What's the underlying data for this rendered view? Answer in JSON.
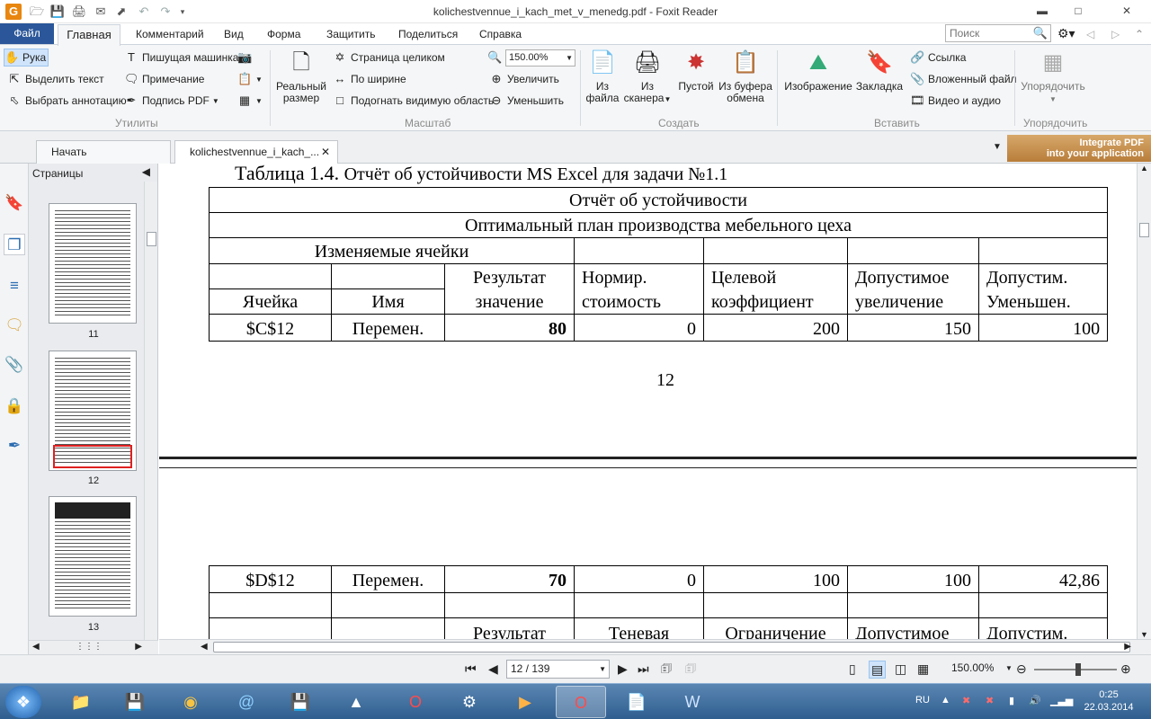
{
  "window": {
    "title": "kolichestvennue_i_kach_met_v_menedg.pdf - Foxit Reader"
  },
  "menubar": {
    "file": "Файл",
    "tabs": [
      "Главная",
      "Комментарий",
      "Вид",
      "Форма",
      "Защитить",
      "Поделиться",
      "Справка"
    ],
    "search_placeholder": "Поиск"
  },
  "ribbon": {
    "utilities": {
      "hand": "Рука",
      "select_text": "Выделить текст",
      "select_annotation": "Выбрать аннотацию",
      "typewriter": "Пишущая машинка",
      "note": "Примечание",
      "sign_pdf": "Подпись PDF",
      "group": "Утилиты"
    },
    "view": {
      "actual_size_1": "Реальный",
      "actual_size_2": "размер",
      "fit_page": "Страница целиком",
      "fit_width": "По ширине",
      "fit_visible": "Подогнать видимую область",
      "zoom": "150.00%",
      "zoom_in": "Увеличить",
      "zoom_out": "Уменьшить",
      "group": "Масштаб"
    },
    "create": {
      "from_file_1": "Из",
      "from_file_2": "файла",
      "from_scanner_1": "Из",
      "from_scanner_2": "сканера",
      "blank": "Пустой",
      "from_clipboard_1": "Из буфера",
      "from_clipboard_2": "обмена",
      "group": "Создать"
    },
    "insert": {
      "image": "Изображение",
      "bookmark": "Закладка",
      "link": "Ссылка",
      "attachment": "Вложенный файл",
      "video_audio": "Видео и аудио",
      "group": "Вставить"
    },
    "arrange": {
      "label": "Упорядочить",
      "group": "Упорядочить"
    }
  },
  "tabs": {
    "start": "Начать",
    "document": "kolichestvennue_i_kach_..."
  },
  "ad": {
    "line1": "Integrate PDF",
    "line2": "into your application"
  },
  "pages_panel": {
    "title": "Страницы",
    "thumbs": [
      "11",
      "12",
      "13"
    ]
  },
  "document": {
    "caption_main": "Таблица 1.4.",
    "caption_rest": "Отчёт об устойчивости MS Excel для задачи №1.1",
    "table_title": "Отчёт об устойчивости",
    "table_subtitle": "Оптимальный план производства мебельного цеха",
    "changing_cells": "Изменяемые ячейки",
    "headers_top": [
      "Результат",
      "Нормир.",
      "Целевой",
      "Допустимое",
      "Допустим."
    ],
    "headers_bottom": [
      "Ячейка",
      "Имя",
      "значение",
      "стоимость",
      "коэффициент",
      "увеличение",
      "Уменьшен."
    ],
    "row1": [
      "$C$12",
      "Перемен.",
      "80",
      "0",
      "200",
      "150",
      "100"
    ],
    "page_number": "12",
    "row2": [
      "$D$12",
      "Перемен.",
      "70",
      "0",
      "100",
      "100",
      "42,86"
    ],
    "headers2_top": [
      "Результат",
      "Теневая",
      "Ограничение",
      "Допустимое",
      "Допустим."
    ]
  },
  "statusbar": {
    "page": "12 / 139",
    "zoom": "150.00%"
  },
  "taskbar": {
    "lang": "RU",
    "time": "0:25",
    "date": "22.03.2014"
  }
}
